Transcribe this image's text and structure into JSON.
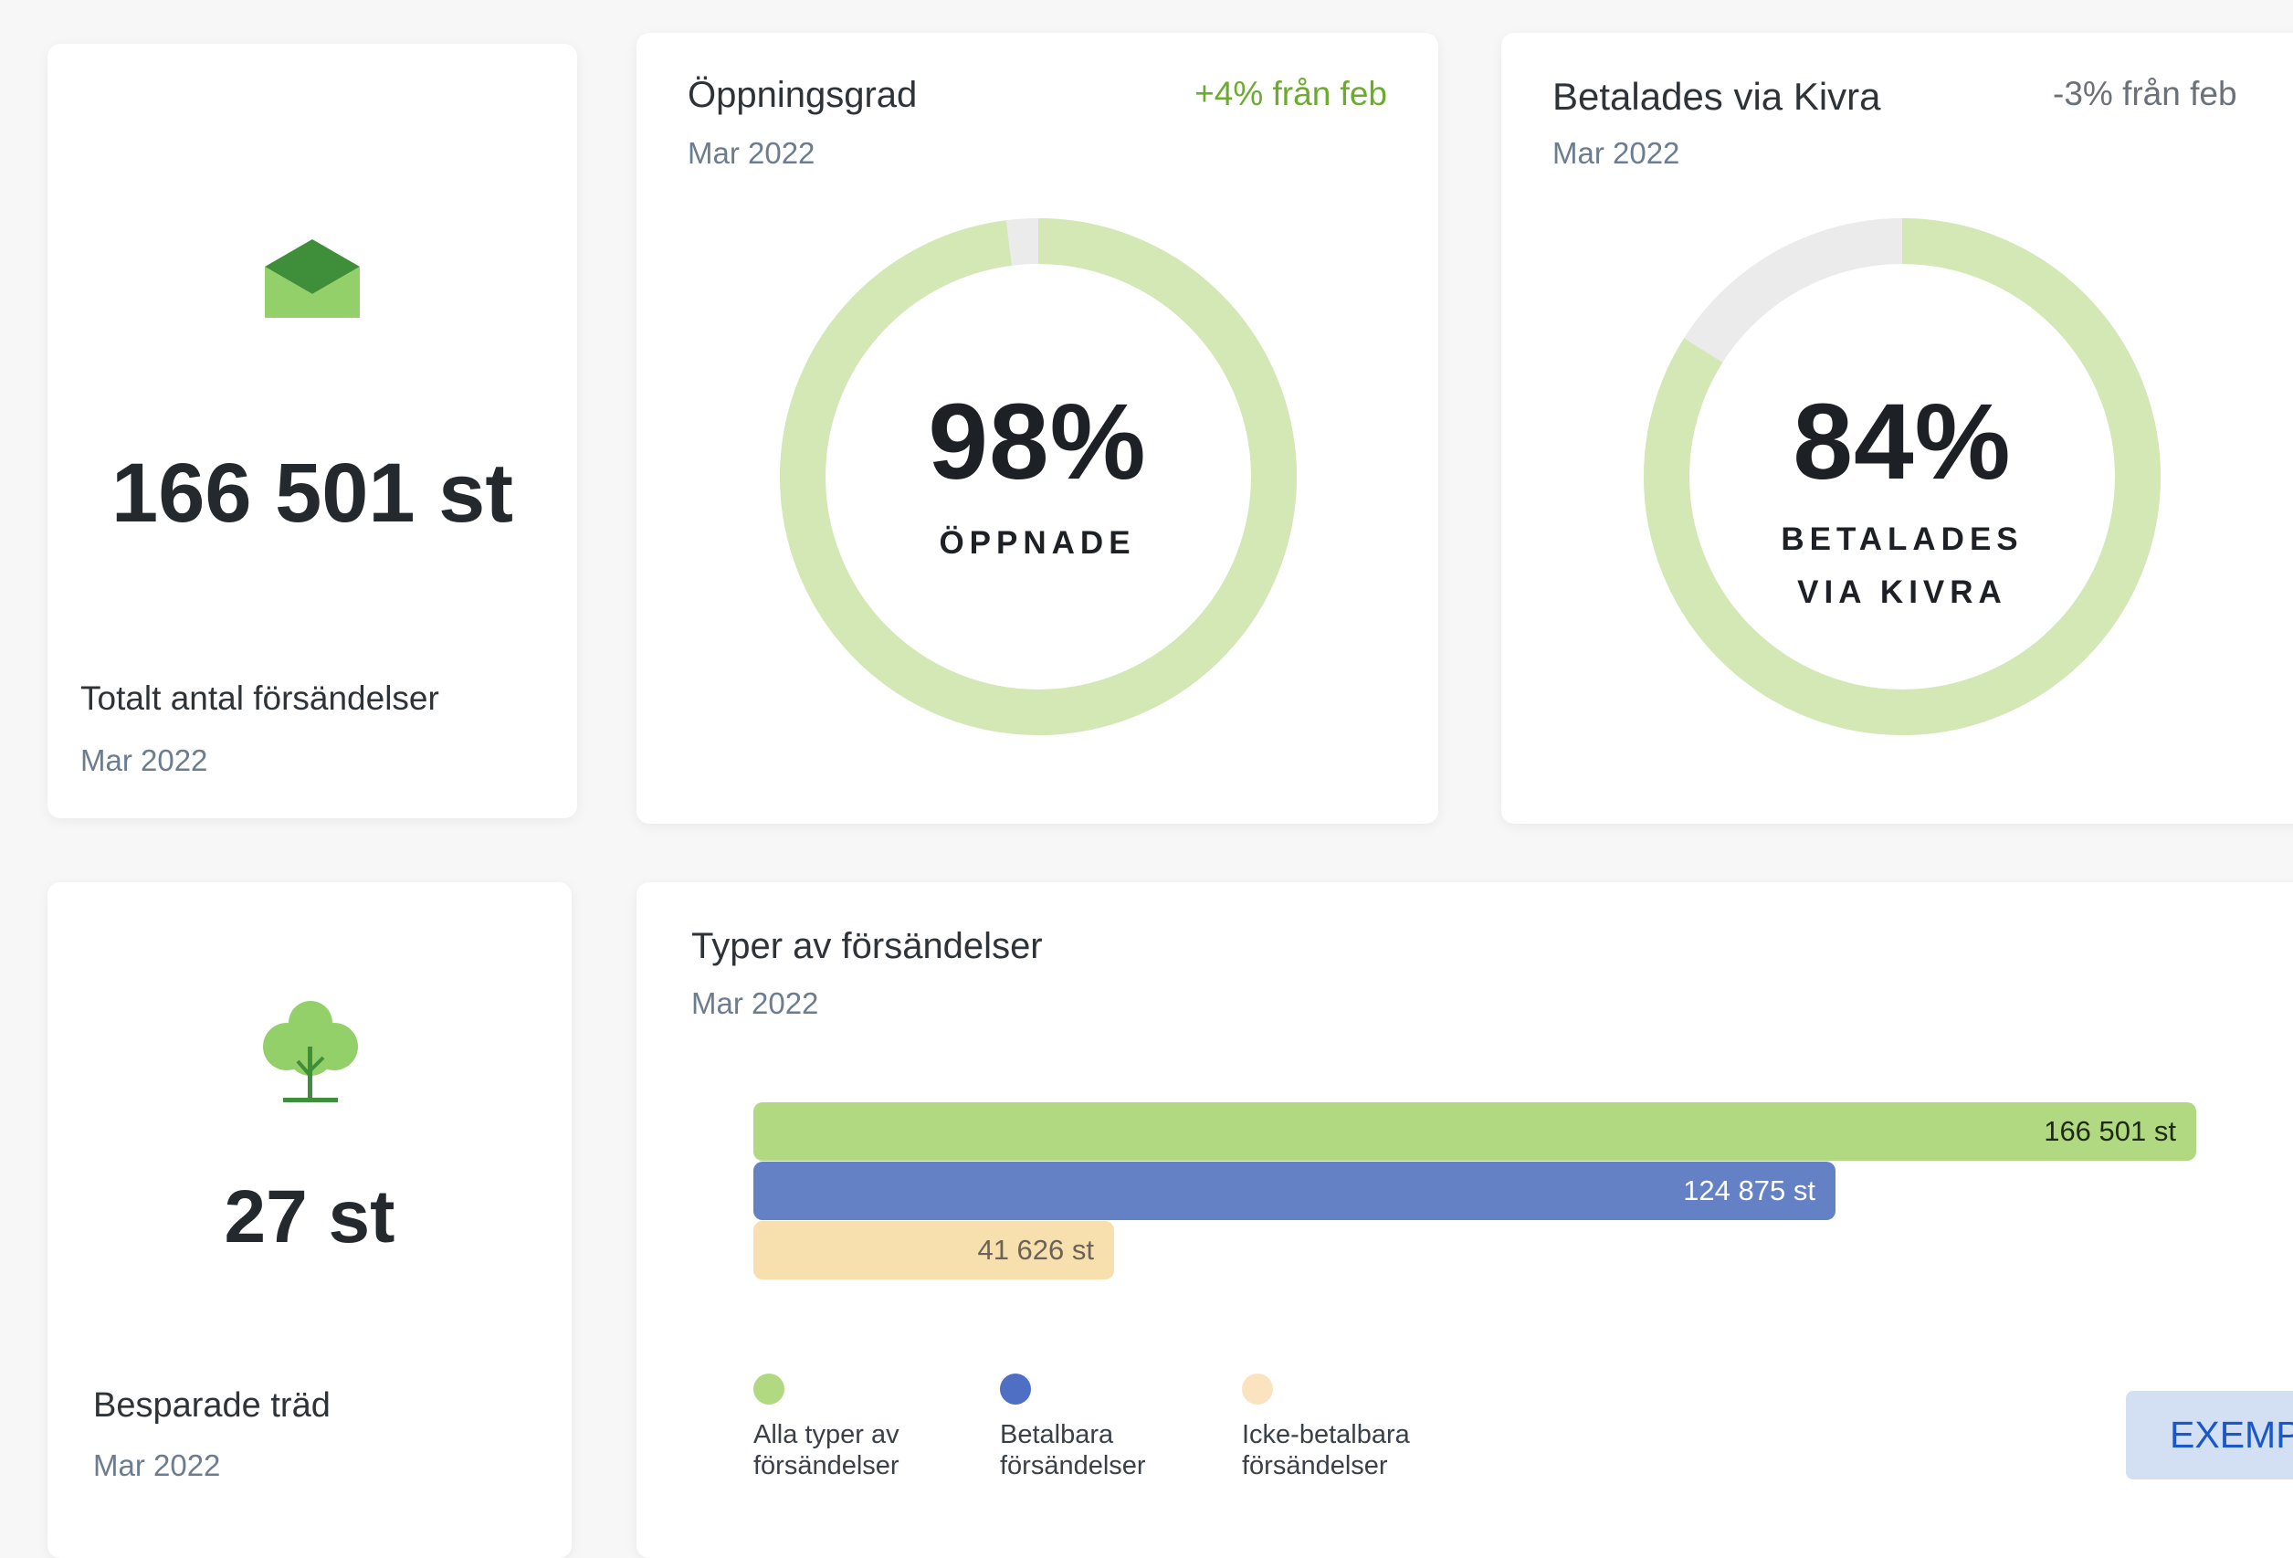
{
  "cards": {
    "total": {
      "value": "166 501 st",
      "label": "Totalt antal försändelser",
      "period": "Mar 2022",
      "icon": "envelope-open-icon"
    },
    "open_rate": {
      "title": "Öppningsgrad",
      "period": "Mar 2022",
      "delta": "+4% från feb",
      "percent_text": "98%",
      "percent_value": 98,
      "center_label": "ÖPPNADE"
    },
    "paid_kivra": {
      "title": "Betalades via Kivra",
      "period": "Mar 2022",
      "delta": "-3% från feb",
      "percent_text": "84%",
      "percent_value": 84,
      "center_label_line1": "BETALADES",
      "center_label_line2": "VIA KIVRA"
    },
    "trees": {
      "value": "27 st",
      "label": "Besparade träd",
      "period": "Mar 2022",
      "icon": "tree-icon"
    },
    "types": {
      "title": "Typer av försändelser",
      "period": "Mar 2022"
    }
  },
  "colors": {
    "positive": "#6cab2e",
    "negative": "#6b7178",
    "donut_fill": "#d3e8b4",
    "donut_track": "#ebebeb",
    "bar_all": "#b1d982",
    "bar_payable": "#6581c6",
    "bar_nonpayable": "#f8dfae",
    "accent_button": "#1a57c9"
  },
  "chart_data": {
    "type": "bar",
    "orientation": "horizontal",
    "title": "Typer av försändelser",
    "categories": [
      "Alla typer av försändelser",
      "Betalbara försändelser",
      "Icke-betalbara försändelser"
    ],
    "values": [
      166501,
      124875,
      41626
    ],
    "value_labels": [
      "166 501 st",
      "124 875 st",
      "41 626 st"
    ],
    "legend": [
      {
        "text": "Alla typer av\nförsändelser",
        "color": "#b1d982"
      },
      {
        "text": "Betalbara\nförsändelser",
        "color": "#4f6fc4"
      },
      {
        "text": "Icke-betalbara\nförsändelser",
        "color": "#fbe3c0"
      }
    ],
    "legend_position": "bottom-left",
    "grid": false
  },
  "button": {
    "label": "EXEMP"
  }
}
